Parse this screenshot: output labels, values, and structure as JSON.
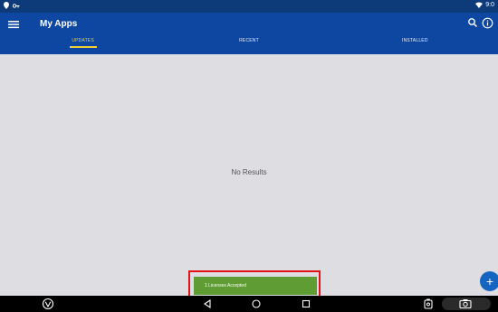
{
  "statusbar": {
    "time": "9:0"
  },
  "appbar": {
    "title": "My Apps"
  },
  "tabs": [
    {
      "label": "UPDATES",
      "active": true
    },
    {
      "label": "RECENT",
      "active": false
    },
    {
      "label": "INSTALLED",
      "active": false
    }
  ],
  "content": {
    "empty_text": "No Results"
  },
  "toast": {
    "text": "1 Licenses Accepted"
  },
  "fab": {
    "label": "+"
  },
  "colors": {
    "appbar": "#0d47a1",
    "statusbar": "#0d3a78",
    "accent": "#f2ce36",
    "toast": "#5f9c34",
    "highlight": "#e31016",
    "fab": "#1565c0",
    "background": "#dedde2"
  },
  "icons": {
    "statusbar_left": [
      "location-icon",
      "key-icon"
    ],
    "statusbar_right": [
      "wifi-icon"
    ],
    "appbar": [
      "menu-icon",
      "search-icon",
      "info-icon"
    ],
    "navbar": [
      "vpn-icon",
      "back-icon",
      "home-icon",
      "recents-icon",
      "screenshot-icon",
      "camera-icon"
    ]
  }
}
